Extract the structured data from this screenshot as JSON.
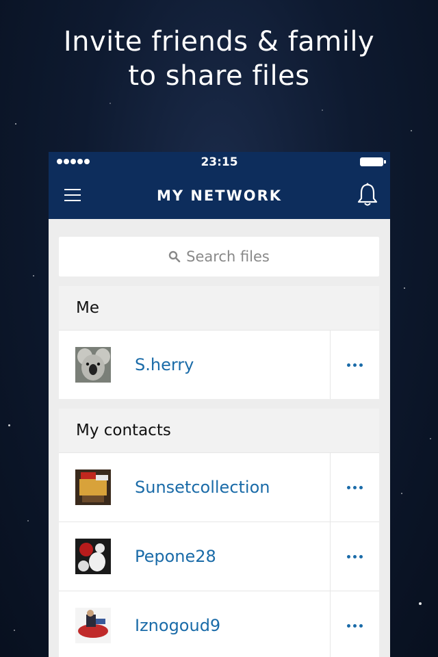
{
  "promo": {
    "line1": "Invite friends & family",
    "line2": "to share files"
  },
  "status_bar": {
    "time": "23:15"
  },
  "nav": {
    "title": "MY NETWORK",
    "menu_icon": "hamburger-icon",
    "bell_icon": "bell-icon"
  },
  "search": {
    "placeholder": "Search files",
    "icon": "search-icon"
  },
  "sections": {
    "me": {
      "header": "Me",
      "items": [
        {
          "name": "S.herry"
        }
      ]
    },
    "contacts": {
      "header": "My contacts",
      "items": [
        {
          "name": "Sunsetcollection"
        },
        {
          "name": "Pepone28"
        },
        {
          "name": "Iznogoud9"
        }
      ]
    }
  },
  "colors": {
    "nav_bg": "#0d2d5c",
    "accent": "#1a6ba8"
  }
}
